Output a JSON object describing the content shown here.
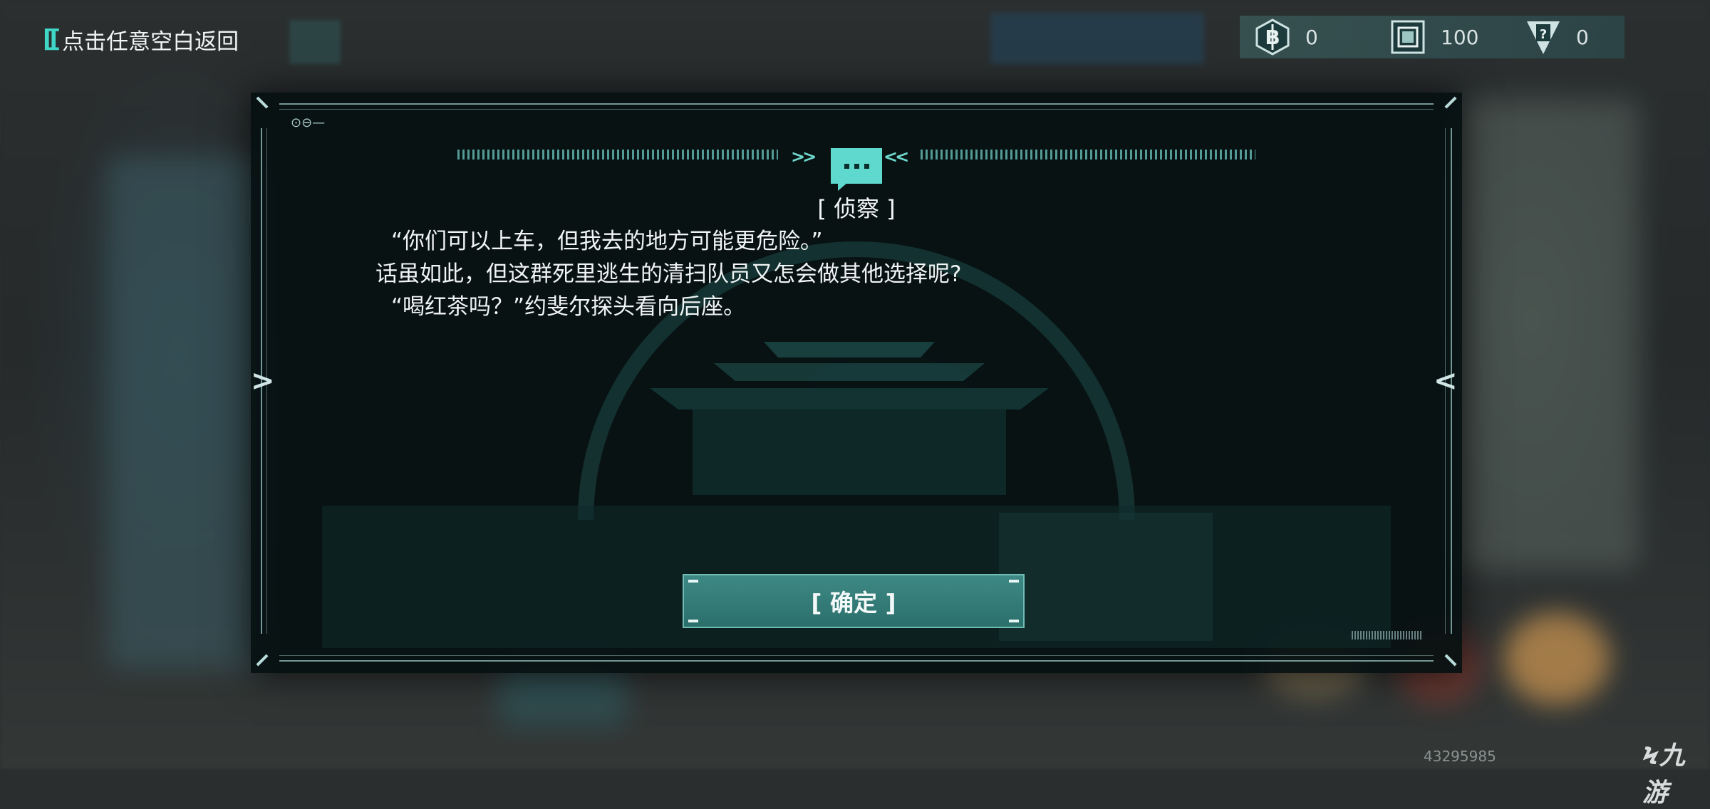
{
  "top_left": {
    "back_hint": "点击任意空白返回",
    "bracket_icon": "double-bracket-icon"
  },
  "currencies": [
    {
      "icon": "b-coin-hex-icon",
      "value": "0"
    },
    {
      "icon": "chip-card-icon",
      "value": "100"
    },
    {
      "icon": "mystery-card-icon",
      "value": "0"
    }
  ],
  "dialog": {
    "header_icon": "chat-bubble-icon",
    "title": "[ 侦察 ]",
    "lines": [
      "“你们可以上车，但我去的地方可能更危险。”",
      "话虽如此，但这群死里逃生的清扫队员又怎会做其他选择呢?",
      "“喝红茶吗？”约斐尔探头看向后座。"
    ],
    "confirm_label": "[ 确定 ]"
  },
  "footer": {
    "id_watermark": "43295985",
    "logo_text": "九游"
  },
  "colors": {
    "accent": "#5fd9cd",
    "button": "#3e8985",
    "dialog_bg": "#061011"
  }
}
